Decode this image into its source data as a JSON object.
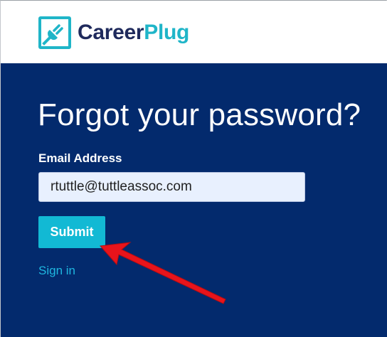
{
  "brand": {
    "name_part1": "Career",
    "name_part2": "Plug",
    "icon": "plug-icon",
    "colors": {
      "navy": "#1f2a5c",
      "teal": "#1fb5c8"
    }
  },
  "form": {
    "title": "Forgot your password?",
    "email_label": "Email Address",
    "email_value": "rtuttle@tuttleassoc.com",
    "submit_label": "Submit",
    "signin_link": "Sign in"
  },
  "annotation": {
    "icon": "red-arrow-icon",
    "color": "#e8141b"
  },
  "colors": {
    "panel_bg": "#032a6d",
    "button_bg": "#12b9d4",
    "link": "#1fb7e0",
    "input_bg": "#e8f0fe"
  }
}
